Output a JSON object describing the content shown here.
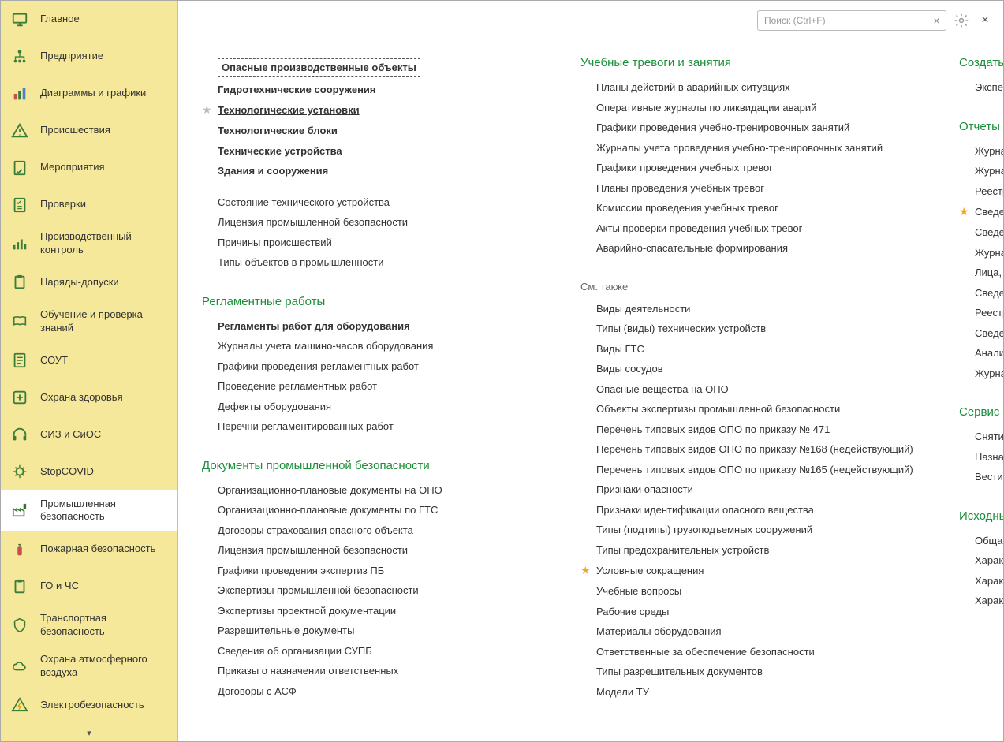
{
  "search": {
    "placeholder": "Поиск (Ctrl+F)"
  },
  "sidebar": {
    "items": [
      {
        "label": "Главное"
      },
      {
        "label": "Предприятие"
      },
      {
        "label": "Диаграммы и графики"
      },
      {
        "label": "Происшествия"
      },
      {
        "label": "Мероприятия"
      },
      {
        "label": "Проверки"
      },
      {
        "label": "Производственный контроль"
      },
      {
        "label": "Наряды-допуски"
      },
      {
        "label": "Обучение и проверка знаний"
      },
      {
        "label": "СОУТ"
      },
      {
        "label": "Охрана здоровья"
      },
      {
        "label": "СИЗ и СиОС"
      },
      {
        "label": "StopCOVID"
      },
      {
        "label": "Промышленная безопасность"
      },
      {
        "label": "Пожарная безопасность"
      },
      {
        "label": "ГО и ЧС"
      },
      {
        "label": "Транспортная безопасность"
      },
      {
        "label": "Охрана атмосферного воздуха"
      },
      {
        "label": "Электробезопасность"
      }
    ]
  },
  "col1": {
    "sec0": {
      "items": [
        "Опасные производственные объекты",
        "Гидротехнические сооружения",
        "Технологические установки",
        "Технологические блоки",
        "Технические устройства",
        "Здания и сооружения"
      ],
      "items2": [
        "Состояние технического устройства",
        "Лицензия промышленной безопасности",
        "Причины происшествий",
        "Типы объектов в промышленности"
      ]
    },
    "sec1": {
      "title": "Регламентные работы",
      "items": [
        "Регламенты работ для оборудования",
        "Журналы учета машино-часов оборудования",
        "Графики проведения регламентных работ",
        "Проведение регламентных работ",
        "Дефекты оборудования",
        "Перечни регламентированных работ"
      ]
    },
    "sec2": {
      "title": "Документы промышленной безопасности",
      "items": [
        "Организационно-плановые документы на ОПО",
        "Организационно-плановые документы по ГТС",
        "Договоры страхования опасного объекта",
        "Лицензия промышленной безопасности",
        "Графики проведения экспертиз ПБ",
        "Экспертизы промышленной безопасности",
        "Экспертизы проектной документации",
        "Разрешительные документы",
        "Сведения об организации СУПБ",
        "Приказы о назначении ответственных",
        "Договоры с АСФ"
      ]
    }
  },
  "col2": {
    "sec0": {
      "title": "Учебные тревоги и занятия",
      "items": [
        "Планы действий в аварийных ситуациях",
        "Оперативные журналы по ликвидации аварий",
        "Графики проведения учебно-тренировочных занятий",
        "Журналы учета проведения учебно-тренировочных занятий",
        "Графики проведения учебных тревог",
        "Планы проведения учебных тревог",
        "Комиссии проведения учебных тревог",
        "Акты проверки проведения учебных тревог",
        "Аварийно-спасательные формирования"
      ]
    },
    "see_also": "См. также",
    "sec1": {
      "items": [
        "Виды деятельности",
        "Типы (виды) технических устройств",
        "Виды ГТС",
        "Виды сосудов",
        "Опасные вещества на ОПО",
        "Объекты экспертизы промышленной безопасности",
        "Перечень типовых видов ОПО по приказу № 471",
        "Перечень типовых видов ОПО по приказу №168 (недействующий)",
        "Перечень типовых видов ОПО по приказу №165 (недействующий)",
        "Признаки опасности",
        "Признаки идентификации опасного вещества",
        "Типы (подтипы) грузоподъемных сооружений",
        "Типы предохранительных устройств",
        "Условные сокращения",
        "Учебные вопросы",
        "Рабочие среды",
        "Материалы оборудования",
        "Ответственные за обеспечение безопасности",
        "Типы разрешительных документов",
        "Модели ТУ"
      ]
    }
  },
  "col3": {
    "sec0": {
      "title": "Создать",
      "items": [
        "Экспе"
      ]
    },
    "sec1": {
      "title": "Отчеты",
      "items": [
        "Журна",
        "Журна",
        "Реестр",
        "Сведе",
        "Сведе",
        "Журна",
        "Лица,",
        "Сведе",
        "Реестр",
        "Сведе",
        "Анали",
        "Журна"
      ]
    },
    "sec2": {
      "title": "Сервис",
      "items": [
        "Сняти",
        "Назна",
        "Вести"
      ]
    },
    "sec3": {
      "title": "Исходнь",
      "items": [
        "Обща",
        "Характ",
        "Характ",
        "Характ"
      ]
    }
  }
}
